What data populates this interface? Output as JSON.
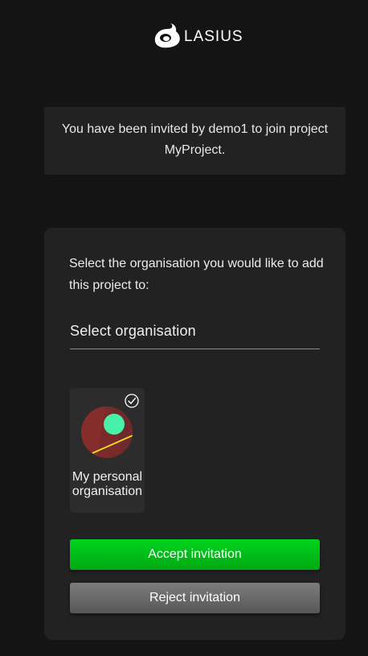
{
  "header": {
    "logo_text": "LASIUS",
    "logo_icon": "lasius-logo-icon"
  },
  "notice": {
    "text": "You have been invited by demo1 to join project MyProject."
  },
  "card": {
    "prompt": "Select the organisation you would like to add this project to:",
    "select_label": "Select organisation",
    "organisations": [
      {
        "name": "My personal organisation",
        "selected": true,
        "avatar_icon": "org-avatar-icon",
        "check_icon": "check-circle-icon"
      }
    ],
    "accept_label": "Accept invitation",
    "reject_label": "Reject invitation"
  },
  "colors": {
    "background": "#141414",
    "panel": "#222222",
    "accept": "#00c01a",
    "reject": "#6a6a6a",
    "avatar_bg": "#7a2a2a",
    "avatar_dot": "#48f0a8",
    "avatar_line": "#f0e020"
  }
}
